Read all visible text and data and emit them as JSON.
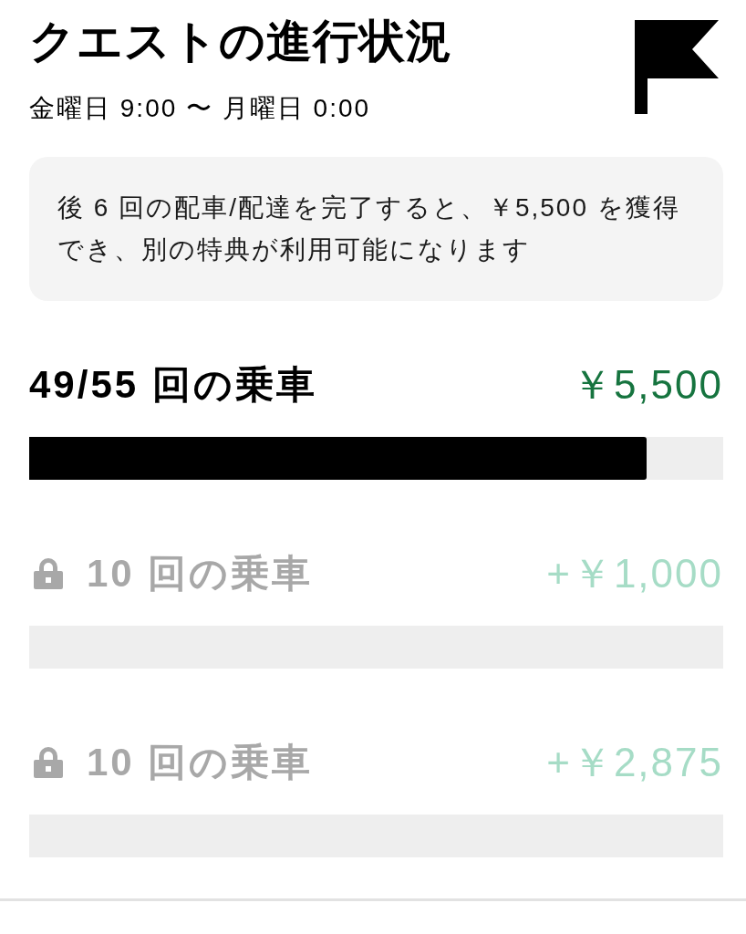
{
  "header": {
    "title": "クエストの進行状況",
    "period": "金曜日 9:00 〜 月曜日 0:00"
  },
  "info": {
    "message": "後 6 回の配車/配達を完了すると、￥5,500 を獲得でき、別の特典が利用可能になります"
  },
  "tiers": [
    {
      "label": "49/55 回の乗車",
      "reward": "￥5,500",
      "level": 0.89,
      "locked": false
    },
    {
      "label": "10 回の乗車",
      "reward": "+￥1,000",
      "locked": true
    },
    {
      "label": "10 回の乗車",
      "reward": "+￥2,875",
      "locked": true
    }
  ]
}
